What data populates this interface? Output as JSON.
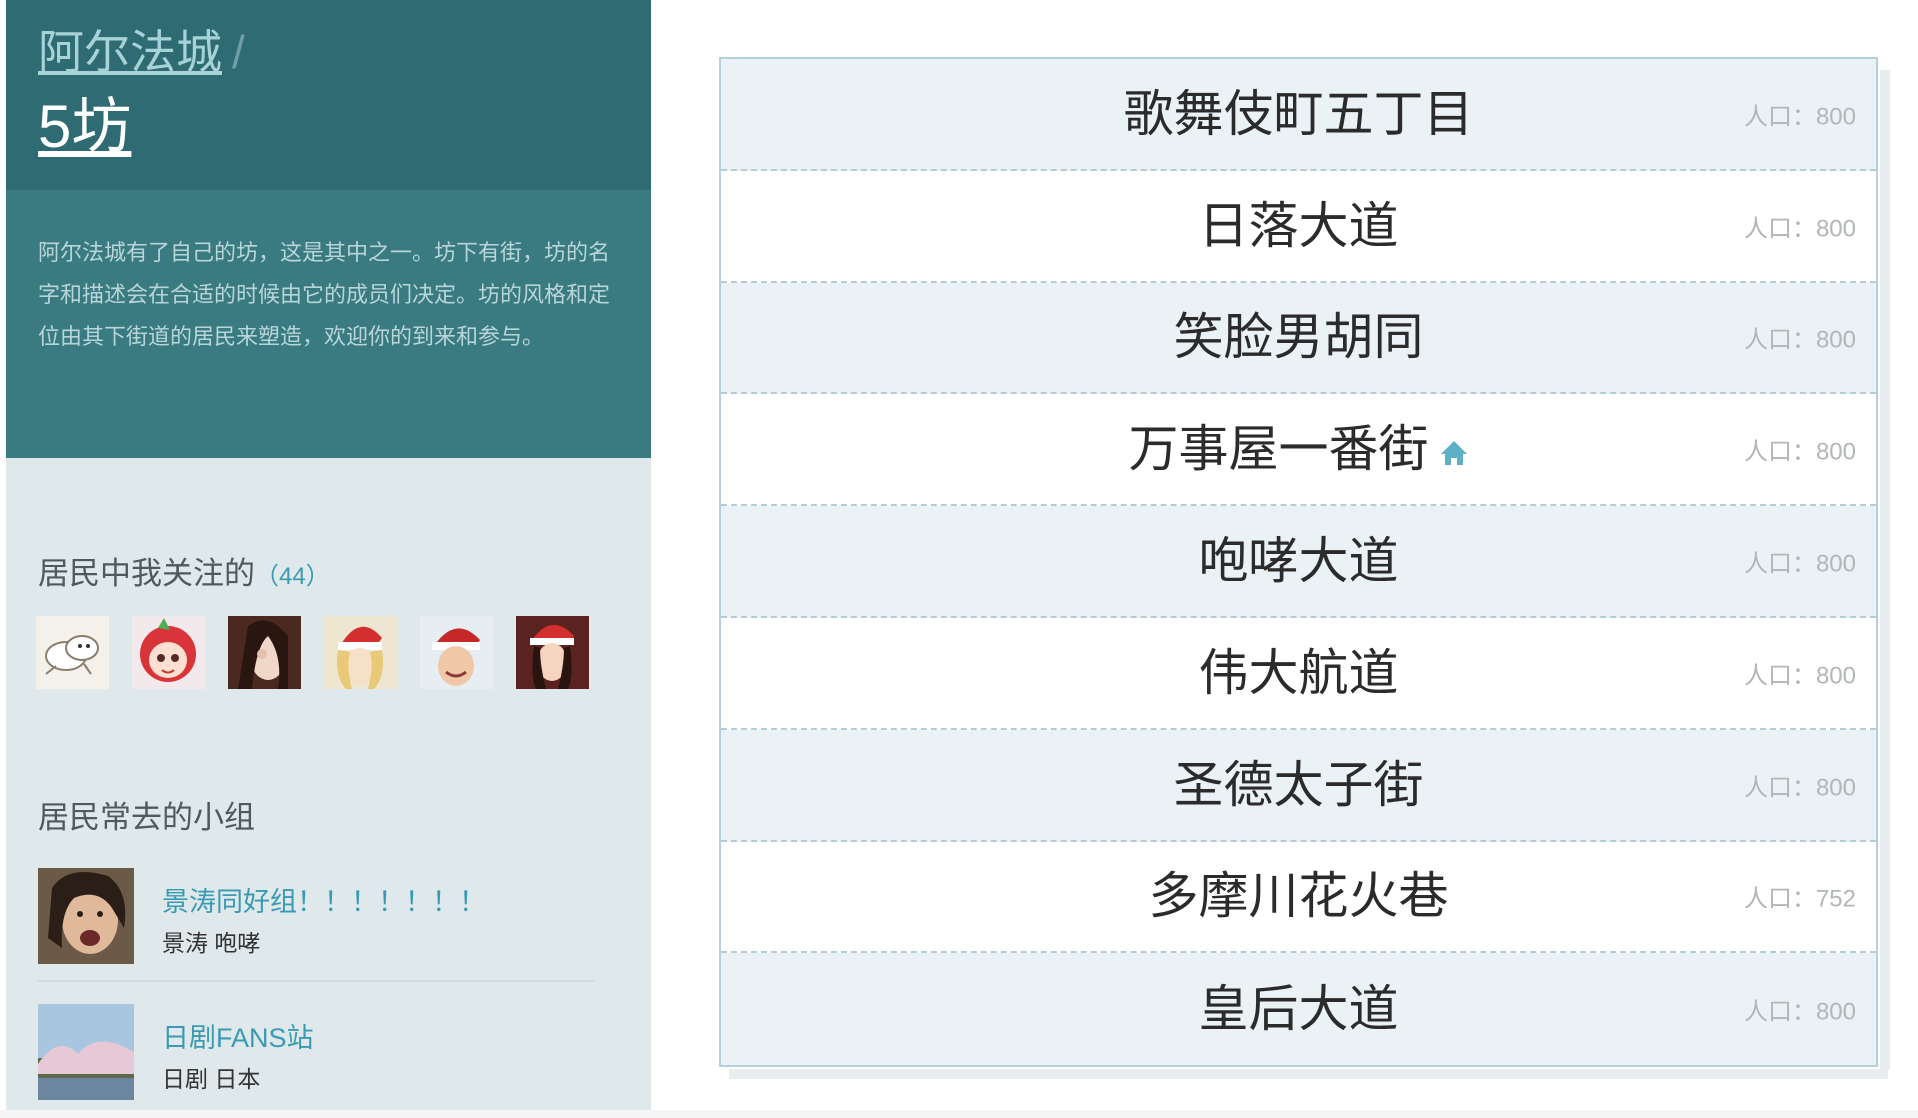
{
  "header": {
    "city_link": "阿尔法城",
    "separator": "/",
    "fang_title": "5坊"
  },
  "description": "阿尔法城有了自己的坊，这是其中之一。坊下有街，坊的名字和描述会在合适的时候由它的成员们决定。坊的风格和定位由其下街道的居民来塑造，欢迎你的到来和参与。",
  "followed_residents": {
    "title": "居民中我关注的",
    "count_open": "（",
    "count": "44",
    "count_close": "）",
    "avatars": [
      {
        "name": "avatar-sheep"
      },
      {
        "name": "avatar-red-hair-girl"
      },
      {
        "name": "avatar-pose"
      },
      {
        "name": "avatar-santa-blonde"
      },
      {
        "name": "avatar-santa-man"
      },
      {
        "name": "avatar-santa-woman"
      }
    ]
  },
  "groups": {
    "title": "居民常去的小组",
    "items": [
      {
        "name": "景涛同好组！！！！！！！",
        "tags": "景涛 咆哮"
      },
      {
        "name": "日剧FANS站",
        "tags": "日剧 日本"
      }
    ]
  },
  "streets": {
    "pop_label": "人口：",
    "items": [
      {
        "name": "歌舞伎町五丁目",
        "population": "800",
        "home": false
      },
      {
        "name": "日落大道",
        "population": "800",
        "home": false
      },
      {
        "name": "笑脸男胡同",
        "population": "800",
        "home": false
      },
      {
        "name": "万事屋一番街",
        "population": "800",
        "home": true
      },
      {
        "name": "咆哮大道",
        "population": "800",
        "home": false
      },
      {
        "name": "伟大航道",
        "population": "800",
        "home": false
      },
      {
        "name": "圣德太子街",
        "population": "800",
        "home": false
      },
      {
        "name": "多摩川花火巷",
        "population": "752",
        "home": false
      },
      {
        "name": "皇后大道",
        "population": "800",
        "home": false
      }
    ]
  },
  "colors": {
    "accent": "#3a9ab2",
    "header_bg": "#2e6b72",
    "desc_bg": "#3a7b82",
    "sidebar_bg": "#dfe9ec"
  }
}
